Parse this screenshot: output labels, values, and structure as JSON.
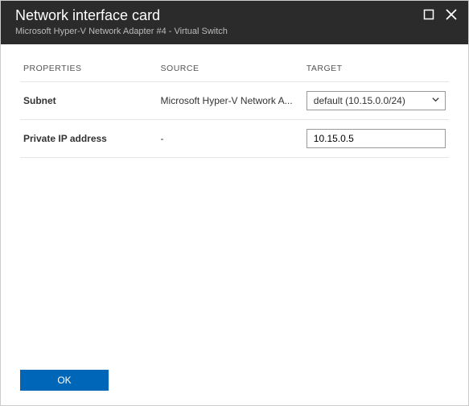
{
  "header": {
    "title": "Network interface card",
    "subtitle": "Microsoft Hyper-V Network Adapter #4 - Virtual Switch"
  },
  "columns": {
    "properties": "PROPERTIES",
    "source": "SOURCE",
    "target": "TARGET"
  },
  "rows": {
    "subnet": {
      "label": "Subnet",
      "source": "Microsoft Hyper-V Network A...",
      "target_selected": "default (10.15.0.0/24)"
    },
    "private_ip": {
      "label": "Private IP address",
      "source": "-",
      "target_value": "10.15.0.5"
    }
  },
  "footer": {
    "ok_label": "OK"
  }
}
